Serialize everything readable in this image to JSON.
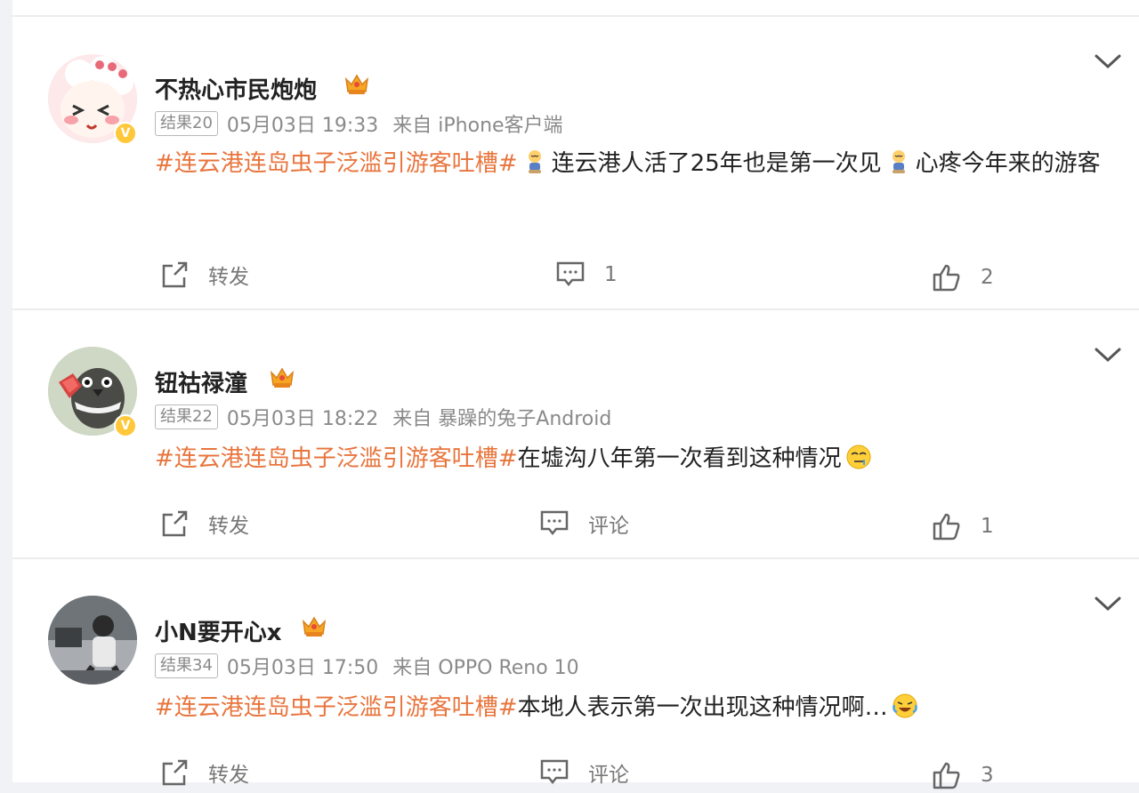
{
  "posts": [
    {
      "user": "不热心市民炮炮",
      "rank": "结果20",
      "time": "05月03日 19:33",
      "source": "来自 iPhone客户端",
      "topic": "#连云港连岛虫子泛滥引游客吐槽#",
      "text_a": "连云港人活了25年也是第一次见",
      "text_b": "心疼今年来的游客",
      "emoji": "stressed-person-emoji",
      "repost_label": "转发",
      "comment_label": "1",
      "like_count": "2"
    },
    {
      "user": "钮祜禄潼",
      "rank": "结果22",
      "time": "05月03日 18:22",
      "source": "来自 暴躁的兔子Android",
      "topic": "#连云港连岛虫子泛滥引游客吐槽#",
      "text": "在墟沟八年第一次看到这种情况",
      "emoji": "drooling-face-emoji",
      "repost_label": "转发",
      "comment_label": "评论",
      "like_count": "1"
    },
    {
      "user": "小N要开心x",
      "rank": "结果34",
      "time": "05月03日 17:50",
      "source": "来自 OPPO Reno 10",
      "topic": "#连云港连岛虫子泛滥引游客吐槽#",
      "text": "本地人表示第一次出现这种情况啊…",
      "emoji": "crying-laughing-emoji",
      "repost_label": "转发",
      "comment_label": "评论",
      "like_count": "3"
    }
  ],
  "colors": {
    "topic": "#e8753d",
    "verified": "#ffc73a",
    "crown": "#f5a623"
  }
}
